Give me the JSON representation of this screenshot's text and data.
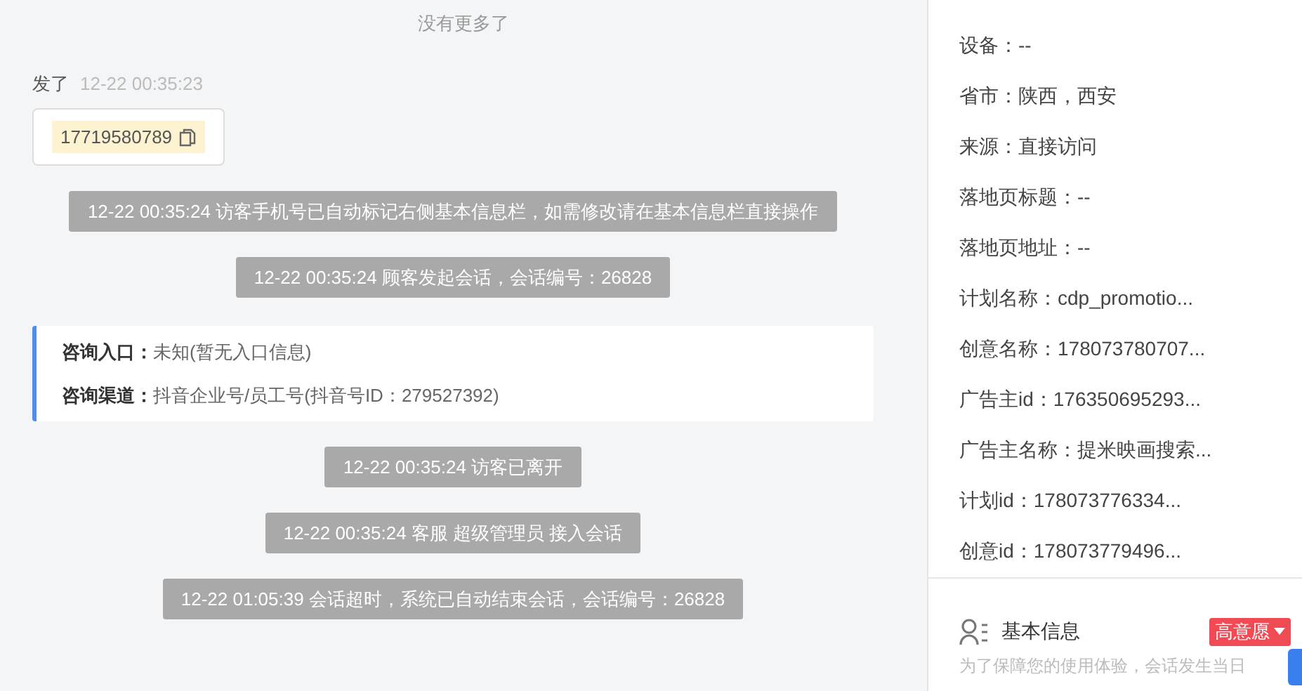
{
  "chat": {
    "end_notice": "没有更多了",
    "message": {
      "sender": "发了",
      "time": "12-22 00:35:23",
      "phone": "17719580789"
    },
    "items": [
      {
        "kind": "system",
        "text": "12-22 00:35:24 访客手机号已自动标记右侧基本信息栏，如需修改请在基本信息栏直接操作"
      },
      {
        "kind": "system",
        "text": "12-22 00:35:24 顾客发起会话，会话编号：26828"
      },
      {
        "kind": "info",
        "rows": [
          {
            "label": "咨询入口：",
            "value": "未知(暂无入口信息)"
          },
          {
            "label": "咨询渠道：",
            "value": "抖音企业号/员工号(抖音号ID：279527392)"
          }
        ]
      },
      {
        "kind": "system",
        "text": "12-22 00:35:24 访客已离开"
      },
      {
        "kind": "system",
        "text": "12-22 00:35:24 客服 超级管理员 接入会话"
      },
      {
        "kind": "system",
        "text": "12-22 01:05:39 会话超时，系统已自动结束会话，会话编号：26828"
      }
    ]
  },
  "details": [
    "设备：--",
    "省市：陕西，西安",
    "来源：直接访问",
    "落地页标题：--",
    "落地页地址：--",
    "计划名称：cdp_promotio...",
    "创意名称：178073780707...",
    "广告主id：176350695293...",
    "广告主名称：提米映画搜索...",
    "计划id：178073776334...",
    "创意id：178073779496..."
  ],
  "basic_info": {
    "title": "基本信息",
    "tag": "高意愿",
    "note": "为了保障您的使用体验，会话发生当日"
  }
}
